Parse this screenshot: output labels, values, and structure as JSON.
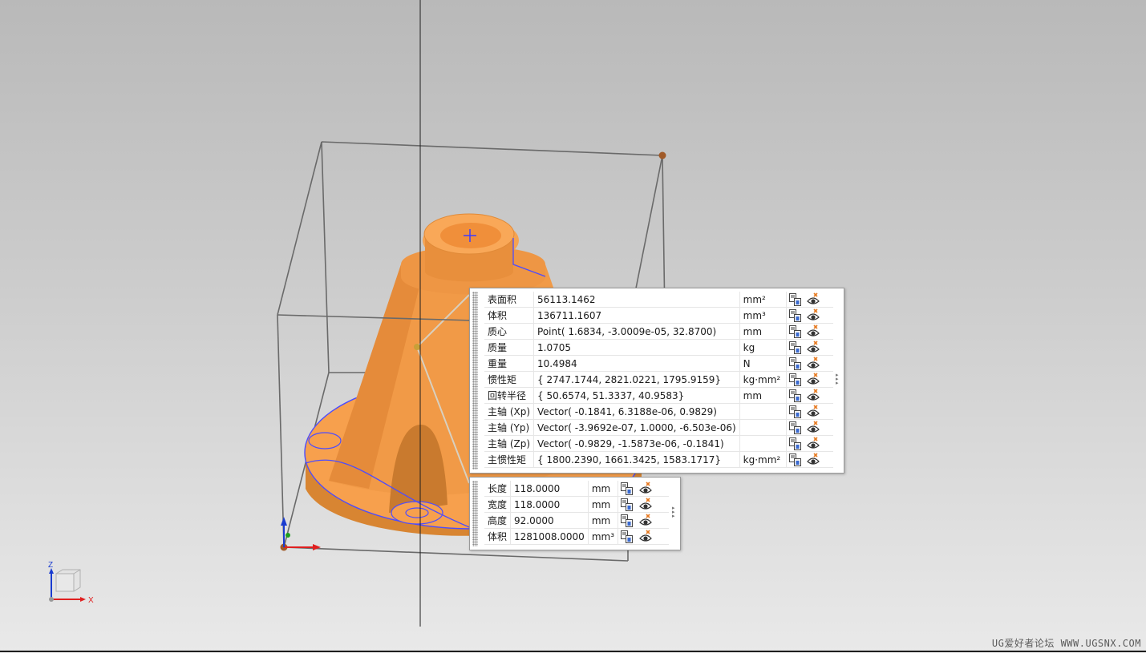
{
  "triad": {
    "z_label": "Z",
    "x_label": "X"
  },
  "colors": {
    "part_orange": "#f7a04d",
    "part_shadow": "#d88532",
    "edge_blue": "#4c4cff",
    "bbox_line": "#6a6a6a",
    "point_brown": "#a05a28"
  },
  "properties_panel": {
    "rows": [
      {
        "label": "表面积",
        "value": "56113.1462",
        "unit": "mm²"
      },
      {
        "label": "体积",
        "value": "136711.1607",
        "unit": "mm³"
      },
      {
        "label": "质心",
        "value": "Point( 1.6834, -3.0009e-05, 32.8700)",
        "unit": "mm"
      },
      {
        "label": "质量",
        "value": "1.0705",
        "unit": "kg"
      },
      {
        "label": "重量",
        "value": "10.4984",
        "unit": "N"
      },
      {
        "label": "惯性矩",
        "value": "{ 2747.1744, 2821.0221, 1795.9159}",
        "unit": "kg·mm²"
      },
      {
        "label": "回转半径",
        "value": "{ 50.6574, 51.3337, 40.9583}",
        "unit": "mm"
      },
      {
        "label": "主轴 (Xp)",
        "value": "Vector( -0.1841, 6.3188e-06, 0.9829)",
        "unit": ""
      },
      {
        "label": "主轴 (Yp)",
        "value": "Vector( -3.9692e-07, 1.0000, -6.503e-06)",
        "unit": ""
      },
      {
        "label": "主轴 (Zp)",
        "value": "Vector( -0.9829, -1.5873e-06, -0.1841)",
        "unit": ""
      },
      {
        "label": "主惯性矩",
        "value": "{ 1800.2390, 1661.3425, 1583.1717}",
        "unit": "kg·mm²"
      }
    ]
  },
  "bounding_box_panel": {
    "rows": [
      {
        "label": "长度",
        "value": "118.0000",
        "unit": "mm"
      },
      {
        "label": "宽度",
        "value": "118.0000",
        "unit": "mm"
      },
      {
        "label": "高度",
        "value": "92.0000",
        "unit": "mm"
      },
      {
        "label": "体积",
        "value": "1281008.0000",
        "unit": "mm³"
      }
    ]
  },
  "icons": {
    "export": "export-to-clipboard-icon",
    "visibility": "show-hide-eye-icon"
  },
  "watermark": "UG爱好者论坛 WWW.UGSNX.COM"
}
